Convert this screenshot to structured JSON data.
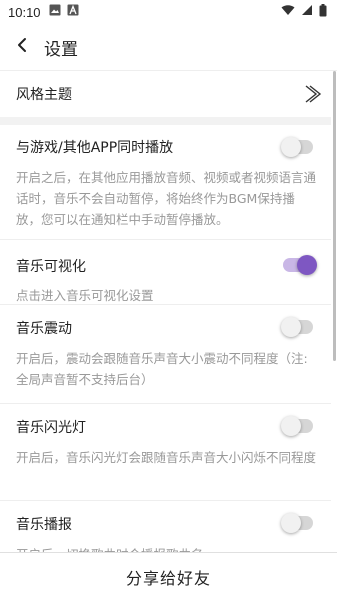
{
  "status": {
    "time": "10:10",
    "icons": [
      "image-icon",
      "a-badge-icon",
      "wifi-icon",
      "signal-icon",
      "battery-icon"
    ]
  },
  "header": {
    "title": "设置",
    "back_icon": "back-arrow-icon"
  },
  "theme_row": {
    "label": "风格主题"
  },
  "settings": [
    {
      "title": "与游戏/其他APP同时播放",
      "description": "开启之后，在其他应用播放音频、视频或者视频语言通话时，音乐不会自动暂停，将始终作为BGM保持播放，您可以在通知栏中手动暂停播放。",
      "enabled": false
    },
    {
      "title": "音乐可视化",
      "description": "点击进入音乐可视化设置",
      "enabled": true
    },
    {
      "title": "音乐震动",
      "description": "开启后，震动会跟随音乐声音大小震动不同程度（注:全局声音暂不支持后台）",
      "enabled": false
    },
    {
      "title": "音乐闪光灯",
      "description": "开启后，音乐闪光灯会跟随音乐声音大小闪烁不同程度",
      "enabled": false
    },
    {
      "title": "音乐播报",
      "description": "开启后，切换歌曲时会播报歌曲名",
      "enabled": false
    }
  ],
  "bottom": {
    "share_label": "分享给好友"
  },
  "colors": {
    "accent": "#7e57c2",
    "accent_track": "#c9b7e6",
    "off_track": "#d6d6d6",
    "description_text": "#999999"
  }
}
